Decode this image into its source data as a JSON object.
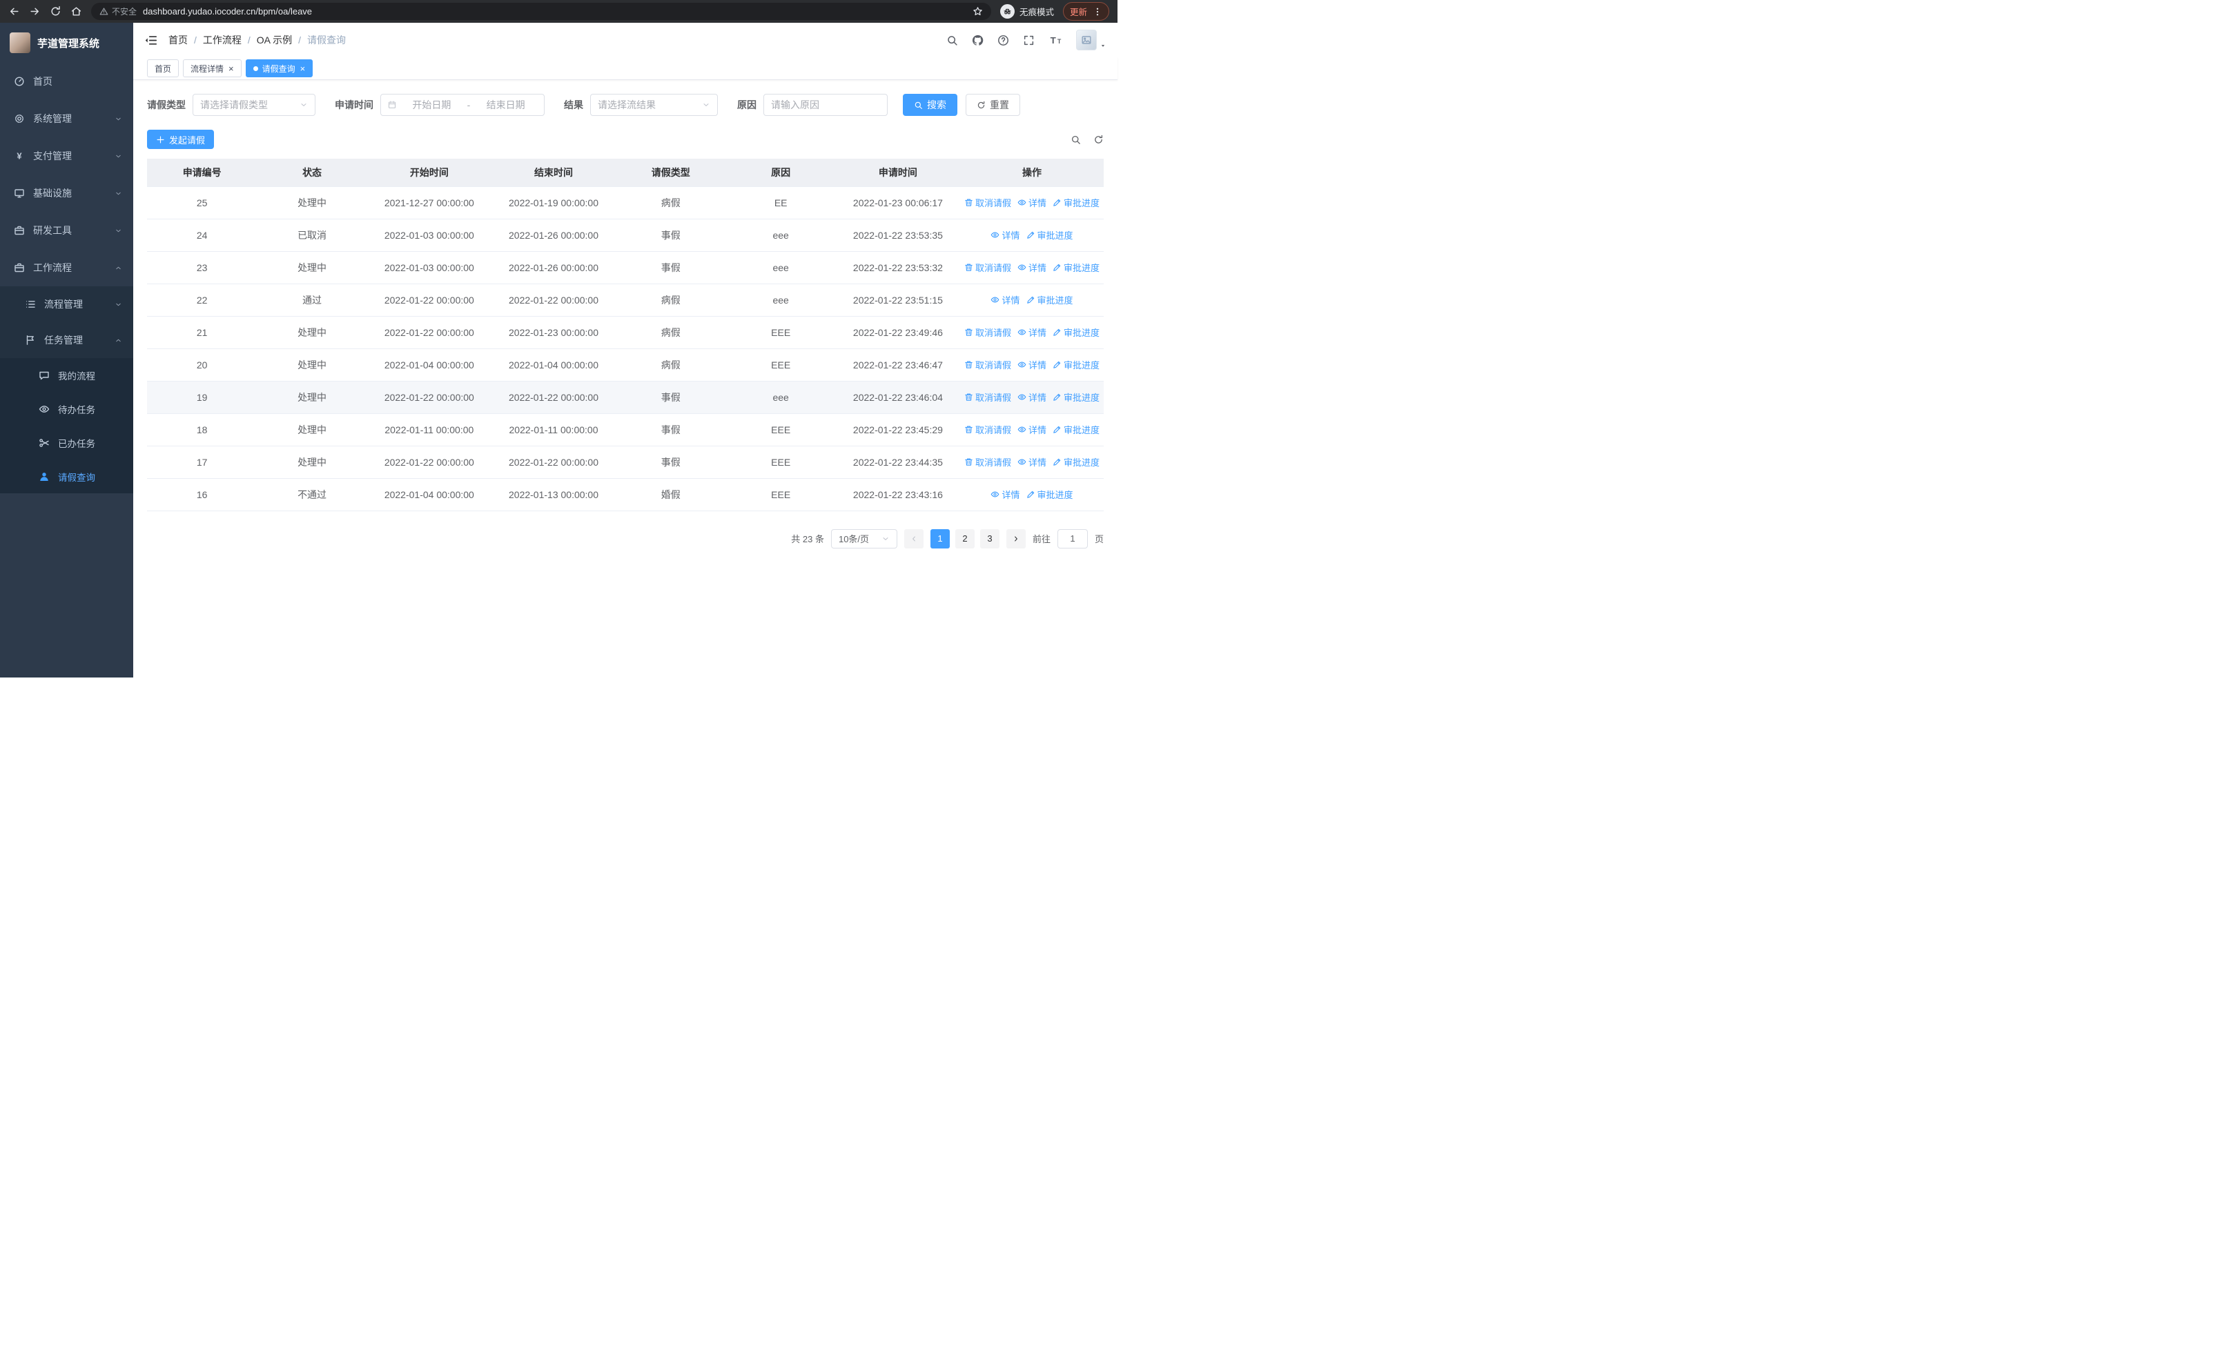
{
  "browser": {
    "warning": "不安全",
    "url": "dashboard.yudao.iocoder.cn/bpm/oa/leave",
    "incognito": "无痕模式",
    "update": "更新"
  },
  "sidebar": {
    "title": "芋道管理系统",
    "menu": [
      {
        "key": "home",
        "label": "首页",
        "icon": "gauge",
        "level": 1
      },
      {
        "key": "system-management",
        "label": "系统管理",
        "icon": "gear",
        "level": 1,
        "arrow": "down"
      },
      {
        "key": "payment-management",
        "label": "支付管理",
        "icon": "yen",
        "level": 1,
        "arrow": "down"
      },
      {
        "key": "infrastructure",
        "label": "基础设施",
        "icon": "monitor",
        "level": 1,
        "arrow": "down"
      },
      {
        "key": "dev-tools",
        "label": "研发工具",
        "icon": "case",
        "level": 1,
        "arrow": "down"
      },
      {
        "key": "workflow",
        "label": "工作流程",
        "icon": "case",
        "level": 1,
        "arrow": "up"
      },
      {
        "key": "process-management",
        "label": "流程管理",
        "icon": "listi",
        "level": 2,
        "arrow": "down",
        "shade": 1
      },
      {
        "key": "task-management",
        "label": "任务管理",
        "icon": "flag",
        "level": 2,
        "arrow": "up",
        "shade": 1
      },
      {
        "key": "my-process",
        "label": "我的流程",
        "icon": "chat",
        "level": 3,
        "shade": 2
      },
      {
        "key": "todo-tasks",
        "label": "待办任务",
        "icon": "eye",
        "level": 3,
        "shade": 2
      },
      {
        "key": "done-tasks",
        "label": "已办任务",
        "icon": "scissors",
        "level": 3,
        "shade": 2
      },
      {
        "key": "leave-query",
        "label": "请假查询",
        "icon": "user",
        "level": 3,
        "shade": 2,
        "active": true
      }
    ]
  },
  "header": {
    "breadcrumb": [
      "首页",
      "工作流程",
      "OA 示例",
      "请假查询"
    ]
  },
  "tabs": [
    {
      "key": "home",
      "label": "首页",
      "closable": false,
      "active": false
    },
    {
      "key": "process-detail",
      "label": "流程详情",
      "closable": true,
      "active": false
    },
    {
      "key": "leave-query",
      "label": "请假查询",
      "closable": true,
      "active": true
    }
  ],
  "filters": {
    "leave_type_label": "请假类型",
    "leave_type_placeholder": "请选择请假类型",
    "apply_time_label": "申请时间",
    "start_date_placeholder": "开始日期",
    "date_separator": "-",
    "end_date_placeholder": "结束日期",
    "result_label": "结果",
    "result_placeholder": "请选择流结果",
    "reason_label": "原因",
    "reason_placeholder": "请输入原因",
    "search_button": "搜索",
    "reset_button": "重置"
  },
  "toolbar": {
    "create_button": "发起请假"
  },
  "table": {
    "columns": [
      "申请编号",
      "状态",
      "开始时间",
      "结束时间",
      "请假类型",
      "原因",
      "申请时间",
      "操作"
    ],
    "action_labels": {
      "cancel": "取消请假",
      "detail": "详情",
      "progress": "审批进度"
    },
    "rows": [
      {
        "id": "25",
        "status": "处理中",
        "start": "2021-12-27 00:00:00",
        "end": "2022-01-19 00:00:00",
        "type": "病假",
        "reason": "EE",
        "applied": "2022-01-23 00:06:17",
        "actions": [
          "cancel",
          "detail",
          "progress"
        ]
      },
      {
        "id": "24",
        "status": "已取消",
        "start": "2022-01-03 00:00:00",
        "end": "2022-01-26 00:00:00",
        "type": "事假",
        "reason": "eee",
        "applied": "2022-01-22 23:53:35",
        "actions": [
          "detail",
          "progress"
        ]
      },
      {
        "id": "23",
        "status": "处理中",
        "start": "2022-01-03 00:00:00",
        "end": "2022-01-26 00:00:00",
        "type": "事假",
        "reason": "eee",
        "applied": "2022-01-22 23:53:32",
        "actions": [
          "cancel",
          "detail",
          "progress"
        ]
      },
      {
        "id": "22",
        "status": "通过",
        "start": "2022-01-22 00:00:00",
        "end": "2022-01-22 00:00:00",
        "type": "病假",
        "reason": "eee",
        "applied": "2022-01-22 23:51:15",
        "actions": [
          "detail",
          "progress"
        ]
      },
      {
        "id": "21",
        "status": "处理中",
        "start": "2022-01-22 00:00:00",
        "end": "2022-01-23 00:00:00",
        "type": "病假",
        "reason": "EEE",
        "applied": "2022-01-22 23:49:46",
        "actions": [
          "cancel",
          "detail",
          "progress"
        ]
      },
      {
        "id": "20",
        "status": "处理中",
        "start": "2022-01-04 00:00:00",
        "end": "2022-01-04 00:00:00",
        "type": "病假",
        "reason": "EEE",
        "applied": "2022-01-22 23:46:47",
        "actions": [
          "cancel",
          "detail",
          "progress"
        ]
      },
      {
        "id": "19",
        "status": "处理中",
        "start": "2022-01-22 00:00:00",
        "end": "2022-01-22 00:00:00",
        "type": "事假",
        "reason": "eee",
        "applied": "2022-01-22 23:46:04",
        "actions": [
          "cancel",
          "detail",
          "progress"
        ],
        "hover": true
      },
      {
        "id": "18",
        "status": "处理中",
        "start": "2022-01-11 00:00:00",
        "end": "2022-01-11 00:00:00",
        "type": "事假",
        "reason": "EEE",
        "applied": "2022-01-22 23:45:29",
        "actions": [
          "cancel",
          "detail",
          "progress"
        ]
      },
      {
        "id": "17",
        "status": "处理中",
        "start": "2022-01-22 00:00:00",
        "end": "2022-01-22 00:00:00",
        "type": "事假",
        "reason": "EEE",
        "applied": "2022-01-22 23:44:35",
        "actions": [
          "cancel",
          "detail",
          "progress"
        ]
      },
      {
        "id": "16",
        "status": "不通过",
        "start": "2022-01-04 00:00:00",
        "end": "2022-01-13 00:00:00",
        "type": "婚假",
        "reason": "EEE",
        "applied": "2022-01-22 23:43:16",
        "actions": [
          "detail",
          "progress"
        ]
      }
    ]
  },
  "pagination": {
    "total": "共 23 条",
    "page_size": "10条/页",
    "pages": [
      "1",
      "2",
      "3"
    ],
    "active_page": "1",
    "goto_label": "前往",
    "goto_value": "1",
    "page_label": "页"
  },
  "colors": {
    "primary": "#409eff",
    "sidebar_bg": "#2d3a4b"
  }
}
